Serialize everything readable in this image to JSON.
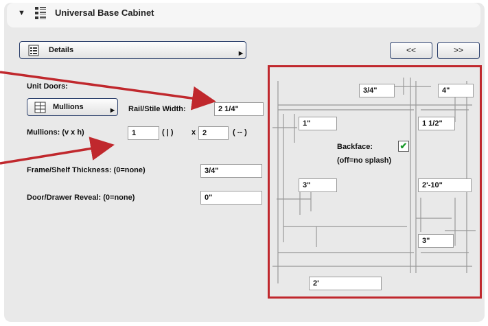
{
  "header": {
    "title": "Universal Base Cabinet",
    "collapse_icon": "triangle-down-icon"
  },
  "details": {
    "label": "Details"
  },
  "nav": {
    "prev_label": "<<",
    "next_label": ">>"
  },
  "unit_doors": {
    "label": "Unit Doors:"
  },
  "mullions_button": {
    "label": "Mullions"
  },
  "rail_stile": {
    "label": "Rail/Stile Width:",
    "value": "2 1/4\""
  },
  "mullions": {
    "label": "Mullions: (v x h)",
    "v_value": "1",
    "v_symbol": "( | )",
    "x_label": "x",
    "h_value": "2",
    "h_symbol": "( -- )"
  },
  "frame_shelf": {
    "label": "Frame/Shelf Thickness: (0=none)",
    "value": "3/4\""
  },
  "reveal": {
    "label": "Door/Drawer Reveal: (0=none)",
    "value": "0\""
  },
  "diagram": {
    "top_middle": "3/4\"",
    "top_right": "4\"",
    "left_upper": "1\"",
    "right_upper": "1 1/2\"",
    "backface_label": "Backface:",
    "backface_note": "(off=no splash)",
    "backface_checked": true,
    "left_middle": "3\"",
    "right_middle": "2'-10\"",
    "right_lower": "3\"",
    "bottom": "2'"
  },
  "colors": {
    "highlight": "#c0282d",
    "check": "#1a9a2a"
  }
}
